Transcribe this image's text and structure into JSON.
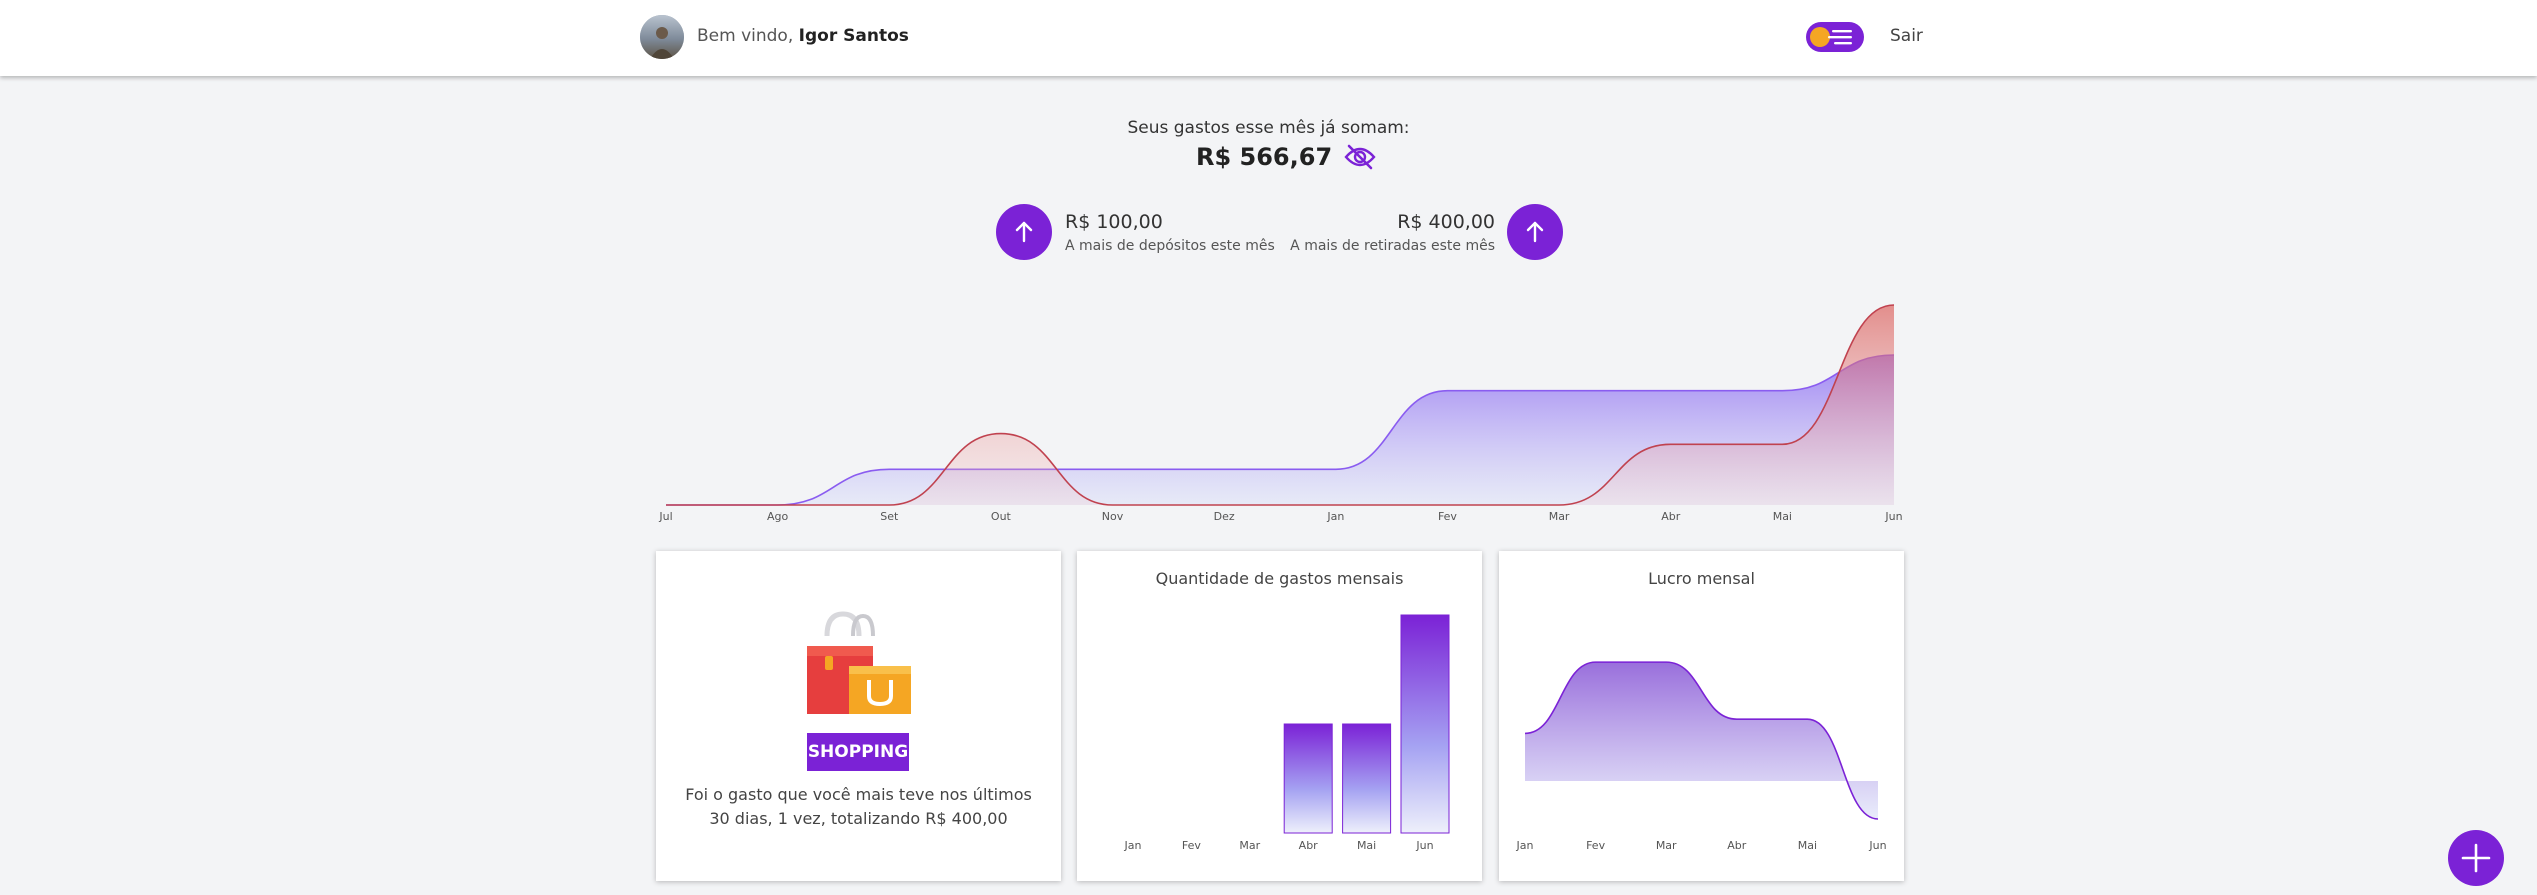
{
  "header": {
    "welcome_prefix": "Bem vindo,",
    "user_name": "Igor Santos",
    "logout_label": "Sair"
  },
  "summary": {
    "label": "Seus gastos esse mês já somam:",
    "total": "R$ 566,67",
    "deposits_amount": "R$ 100,00",
    "deposits_label": "A mais de depósitos este mês",
    "withdrawals_amount": "R$ 400,00",
    "withdrawals_label": "A mais de retiradas este mês"
  },
  "top_category": {
    "badge": "SHOPPING",
    "description": "Foi o gasto que você mais teve nos últimos 30 dias, 1 vez, totalizando R$ 400,00"
  },
  "colors": {
    "accent": "#7b22d6",
    "deposit_series": "#8a5cf0",
    "withdrawal_series": "#c0424f"
  },
  "chart_data": [
    {
      "type": "area",
      "categories": [
        "Jul",
        "Ago",
        "Set",
        "Out",
        "Nov",
        "Dez",
        "Jan",
        "Fev",
        "Mar",
        "Abr",
        "Mai",
        "Jun"
      ],
      "series": [
        {
          "values": [
            0,
            0,
            1,
            1,
            1,
            1,
            1,
            3.2,
            3.2,
            3.2,
            3.2,
            4.2
          ]
        },
        {
          "values": [
            0,
            0,
            0,
            2,
            0,
            0,
            0,
            0,
            0,
            1.7,
            1.7,
            5.6
          ]
        }
      ],
      "ylim": [
        0,
        5.6
      ],
      "grid": false
    },
    {
      "type": "bar",
      "title": "Quantidade de gastos mensais",
      "categories": [
        "Jan",
        "Fev",
        "Mar",
        "Abr",
        "Mai",
        "Jun"
      ],
      "values": [
        0,
        0,
        0,
        2,
        2,
        4
      ],
      "ylim": [
        0,
        4
      ],
      "grid": false
    },
    {
      "type": "area",
      "title": "Lucro mensal",
      "categories": [
        "Jan",
        "Fev",
        "Mar",
        "Abr",
        "Mai",
        "Jun"
      ],
      "values": [
        0.5,
        1.5,
        1.5,
        0.7,
        0.7,
        -0.7
      ],
      "ylim": [
        -0.7,
        1.6
      ],
      "grid": false
    }
  ]
}
